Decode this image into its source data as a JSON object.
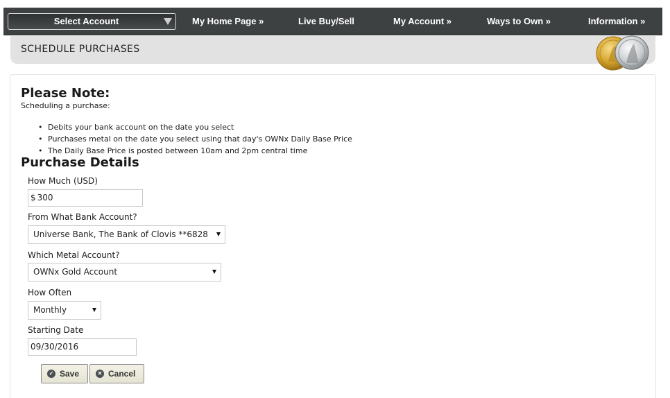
{
  "nav": {
    "account_select": "Select Account",
    "items": [
      {
        "label": "My Home Page »"
      },
      {
        "label": "Live Buy/Sell"
      },
      {
        "label": "My Account »"
      },
      {
        "label": "Ways to Own »"
      },
      {
        "label": "Information »"
      }
    ]
  },
  "header": {
    "title": "SCHEDULE PURCHASES",
    "colors": {
      "gold": "#d4a32b",
      "silver": "#c9ccce"
    }
  },
  "note": {
    "heading": "Please Note:",
    "subtitle": "Scheduling a purchase:",
    "bullets": [
      "Debits your bank account on the date you select",
      "Purchases metal on the date you select using that day's OWNx Daily Base Price",
      "The Daily Base Price is posted between 10am and 2pm central time"
    ]
  },
  "purchase": {
    "heading": "Purchase Details",
    "amount": {
      "label": "How Much (USD)",
      "currency": "$",
      "value": "300"
    },
    "bank": {
      "label": "From What Bank Account?",
      "value": "Universe Bank, The Bank of Clovis **6828"
    },
    "metal": {
      "label": "Which Metal Account?",
      "value": "OWNx Gold Account"
    },
    "frequency": {
      "label": "How Often",
      "value": "Monthly"
    },
    "start_date": {
      "label": "Starting Date",
      "value": "09/30/2016"
    }
  },
  "actions": {
    "save": "Save",
    "cancel": "Cancel"
  },
  "colors": {
    "nav_bg": "#3d4142",
    "header_bg": "#e2e2e2",
    "button_bg": "#efeddd"
  }
}
